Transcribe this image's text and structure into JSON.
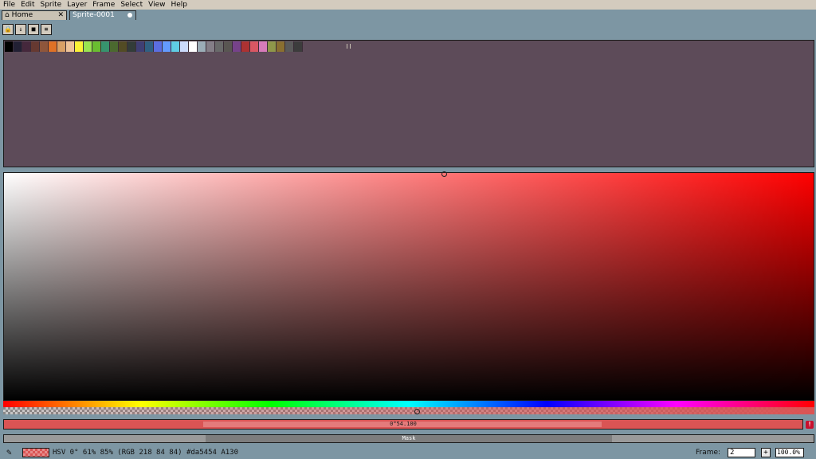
{
  "menu": [
    "File",
    "Edit",
    "Sprite",
    "Layer",
    "Frame",
    "Select",
    "View",
    "Help"
  ],
  "tabs": {
    "home": {
      "label": "Home",
      "close": "✕"
    },
    "sprite": {
      "label": "Sprite-0001"
    }
  },
  "palette_tools": [
    {
      "name": "lock-icon",
      "glyph": "🔒"
    },
    {
      "name": "download-icon",
      "glyph": "↓"
    },
    {
      "name": "square-icon",
      "glyph": "■"
    },
    {
      "name": "menu-icon",
      "glyph": "≡"
    }
  ],
  "palette": [
    "#000000",
    "#222034",
    "#45283c",
    "#663931",
    "#8f563b",
    "#df7126",
    "#d9a066",
    "#eec39a",
    "#fbf236",
    "#99e550",
    "#6abe30",
    "#37946e",
    "#4b692f",
    "#524b24",
    "#323c39",
    "#3f3f74",
    "#306082",
    "#5b6ee1",
    "#639bff",
    "#5fcde4",
    "#cbdbfc",
    "#ffffff",
    "#9badb7",
    "#847e87",
    "#696a6a",
    "#595652",
    "#76428a",
    "#ac3232",
    "#d95763",
    "#d77bba",
    "#8f974a",
    "#8a6f30",
    "#5a5a5a",
    "#3c3c3c"
  ],
  "color_entry": {
    "value": "0°54.100"
  },
  "mask": {
    "label": "Mask"
  },
  "status": {
    "color_info": "HSV 0° 61% 85% (RGB 218 84 84) #da5454 A130",
    "frame_label": "Frame:",
    "frame_value": "2",
    "add_frame": "+",
    "zoom_value": "100.0%"
  },
  "warning": "!",
  "current_color": "#da5454"
}
